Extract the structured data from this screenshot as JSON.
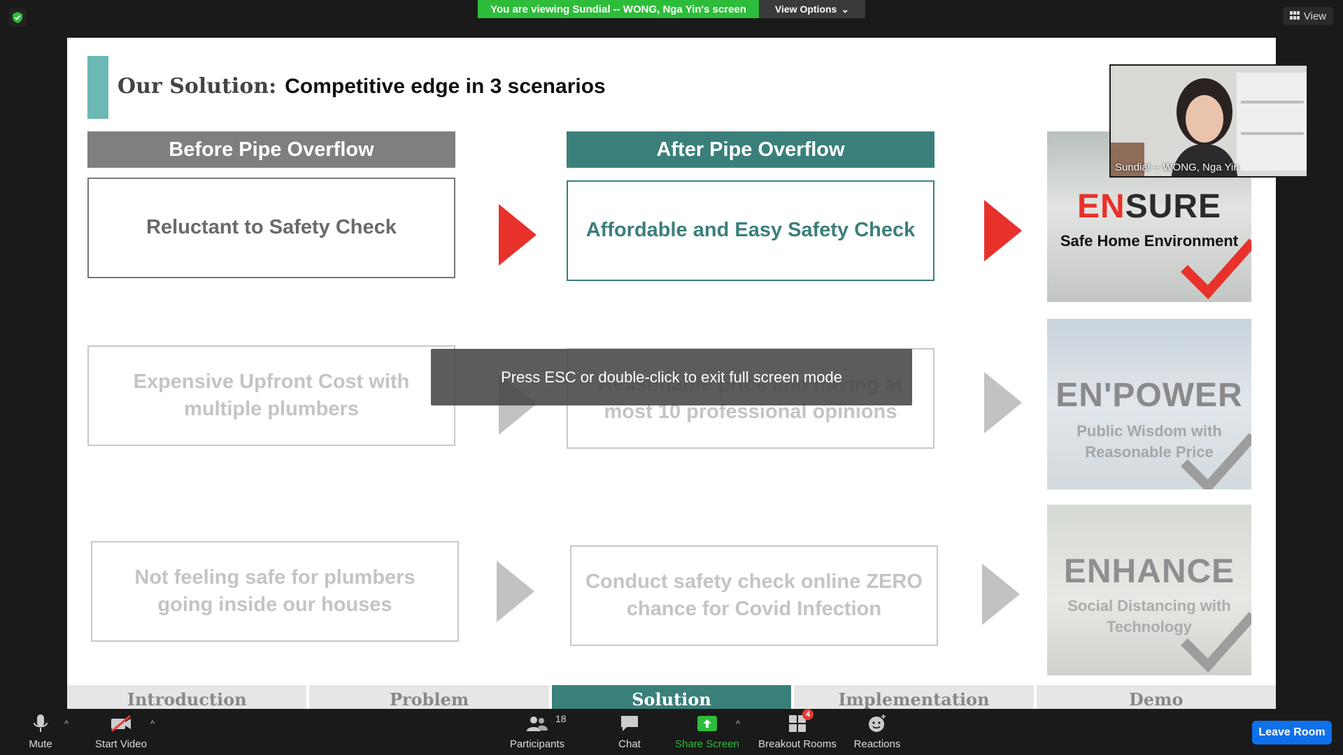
{
  "top": {
    "viewing_banner": "You are viewing Sundial -- WONG, Nga Yin's screen",
    "view_options": "View Options",
    "view_button": "View"
  },
  "slide": {
    "title_part1": "Our Solution:",
    "title_part2": "Competitive edge in 3 scenarios",
    "col_before": "Before Pipe Overflow",
    "col_after": "After Pipe Overflow",
    "rows": [
      {
        "before": "Reluctant to Safety Check",
        "after": "Affordable and Easy Safety Check"
      },
      {
        "before": "Expensive Upfront Cost with multiple plumbers",
        "after": "Reasonable price and having at most 10 professional opinions"
      },
      {
        "before": "Not feeling safe for plumbers going inside our houses",
        "after": "Conduct safety check online ZERO chance for Covid Infection"
      }
    ],
    "tiles": [
      {
        "title_prefix": "EN",
        "title_rest": "SURE",
        "subtitle": "Safe Home Environment"
      },
      {
        "title_prefix": "EN'",
        "title_rest": "POWER",
        "subtitle": "Public Wisdom with Reasonable Price"
      },
      {
        "title_prefix": "EN",
        "title_rest": "HANCE",
        "subtitle": "Social Distancing with Technology"
      }
    ],
    "nav_tabs": [
      "Introduction",
      "Problem",
      "Solution",
      "Implementation",
      "Demo"
    ],
    "active_tab": "Solution"
  },
  "toast": "Press ESC or double-click to exit full screen mode",
  "video": {
    "name": "Sundial -- WONG, Nga Yin"
  },
  "toolbar": {
    "mute": "Mute",
    "start_video": "Start Video",
    "participants": "Participants",
    "participants_count": "18",
    "chat": "Chat",
    "share_screen": "Share Screen",
    "breakout_rooms": "Breakout Rooms",
    "breakout_badge": "4",
    "reactions": "Reactions",
    "leave_room": "Leave Room"
  },
  "colors": {
    "accent_teal": "#3b7f7b",
    "arrow_red": "#e8312b",
    "share_green": "#2dbd3a",
    "leave_blue": "#0e71eb"
  }
}
